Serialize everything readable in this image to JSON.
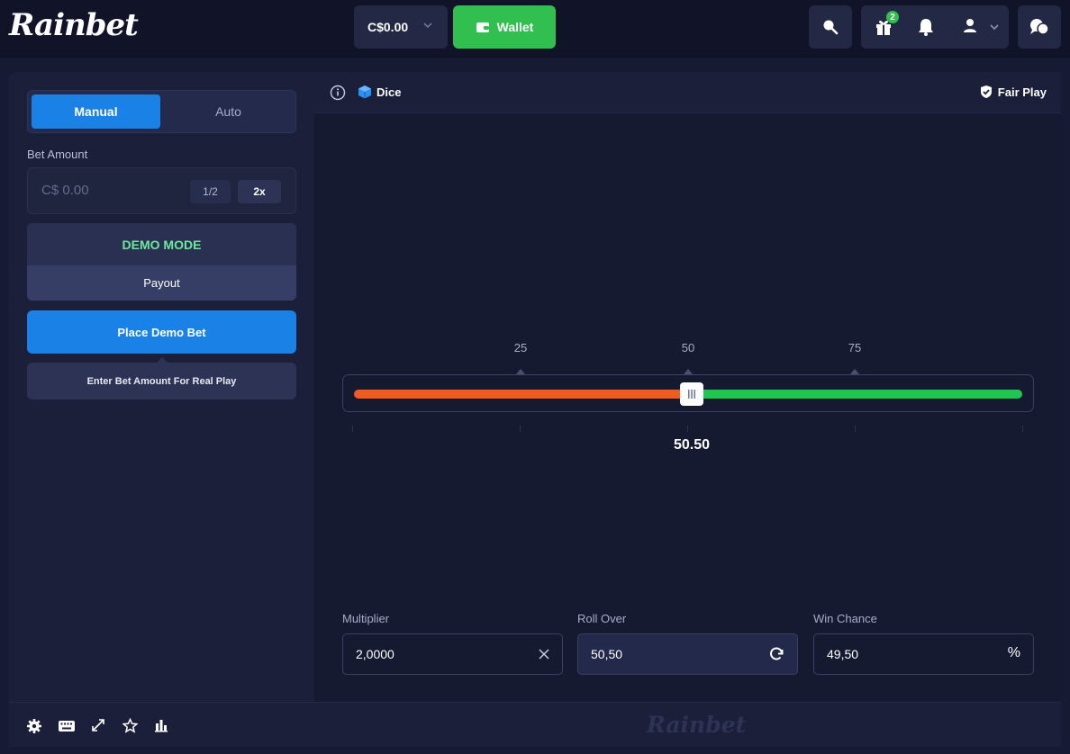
{
  "header": {
    "logo": "Rainbet",
    "balance": "C$0.00",
    "wallet_label": "Wallet",
    "notification_badge": "2"
  },
  "left": {
    "mode_manual": "Manual",
    "mode_auto": "Auto",
    "bet_amount_label": "Bet Amount",
    "bet_amount_placeholder": "C$ 0.00",
    "half_label": "1/2",
    "double_label": "2x",
    "demo_mode": "DEMO MODE",
    "payout_label": "Payout",
    "place_bet_label": "Place Demo Bet",
    "real_play_hint": "Enter Bet Amount For Real Play"
  },
  "game": {
    "title": "Dice",
    "fair_play": "Fair Play",
    "ticks": [
      "25",
      "50",
      "75"
    ],
    "slider_value": "50.50",
    "roll_over_fraction": 0.505,
    "colors": {
      "lose": "#f15a22",
      "win": "#23c552",
      "accent": "#1a81e6"
    },
    "multiplier_label": "Multiplier",
    "multiplier_value": "2,0000",
    "roll_over_label": "Roll Over",
    "roll_over_value": "50,50",
    "win_chance_label": "Win Chance",
    "win_chance_value": "49,50",
    "percent_symbol": "%"
  },
  "footer": {
    "logo": "Rainbet",
    "icons": [
      "gear-icon",
      "keyboard-icon",
      "expand-icon",
      "star-icon",
      "stats-icon"
    ]
  }
}
